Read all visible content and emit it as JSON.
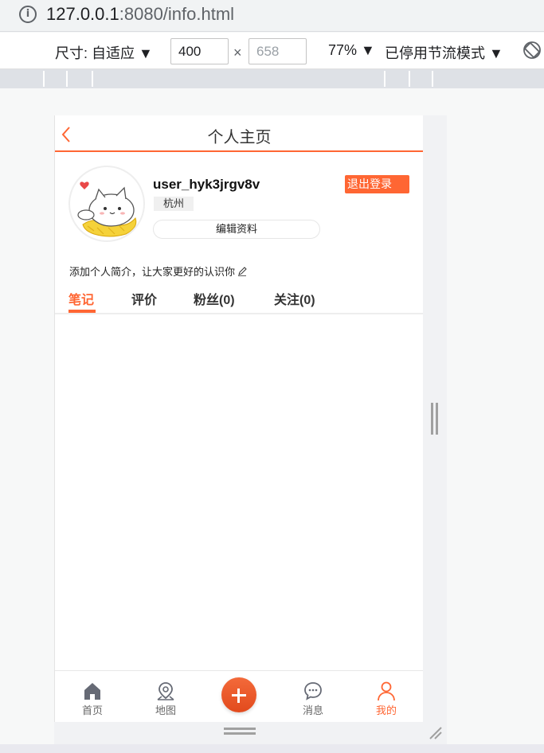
{
  "browser": {
    "url_host": "127.0.0.1",
    "url_rest": ":8080/info.html"
  },
  "devtools": {
    "dimensions_label": "尺寸: 自适应 ▼",
    "width_value": "400",
    "times": "×",
    "height_placeholder": "658",
    "zoom_label": "77% ▼",
    "throttle_label": "已停用节流模式 ▼"
  },
  "app": {
    "title": "个人主页",
    "username": "user_hyk3jrgv8v",
    "logout_label": "退出登录",
    "city": "杭州",
    "edit_label": "编辑资料",
    "intro": "添加个人简介，让大家更好的认识你",
    "tabs": [
      {
        "label": "笔记"
      },
      {
        "label": "评价"
      },
      {
        "label": "粉丝(0)"
      },
      {
        "label": "关注(0)"
      }
    ],
    "nav": [
      {
        "label": "首页",
        "icon": "home-icon"
      },
      {
        "label": "地图",
        "icon": "map-pin-icon"
      },
      {
        "label": "",
        "icon": "plus-icon"
      },
      {
        "label": "消息",
        "icon": "message-icon"
      },
      {
        "label": "我的",
        "icon": "user-icon"
      }
    ],
    "colors": {
      "accent": "#ff6633",
      "text": "#333333"
    }
  }
}
